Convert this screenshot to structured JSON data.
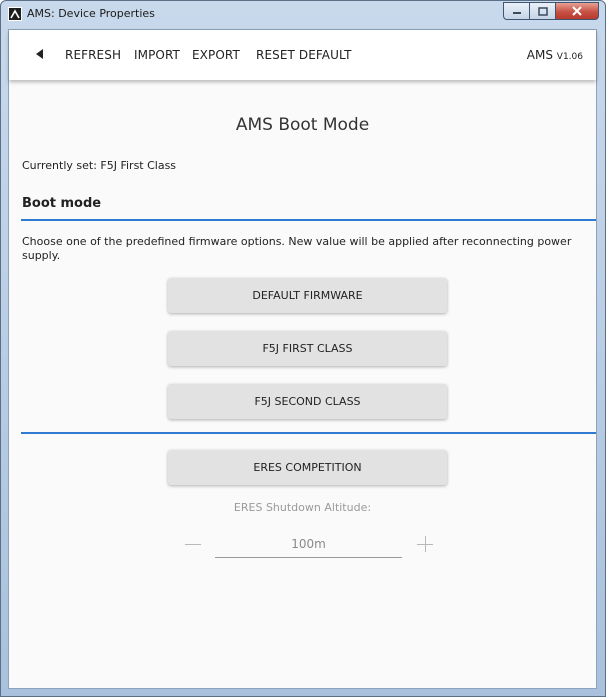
{
  "window": {
    "title": "AMS: Device Properties",
    "controls": {
      "minimize": "minimize",
      "maximize": "maximize",
      "close": "close"
    }
  },
  "toolbar": {
    "refresh": "REFRESH",
    "import": "IMPORT",
    "export": "EXPORT",
    "reset_default": "RESET DEFAULT",
    "app_name": "AMS",
    "version": "V1.06"
  },
  "main": {
    "title": "AMS Boot Mode",
    "current": "Currently set: F5J First Class",
    "section_title": "Boot mode",
    "description": "Choose one of the predefined firmware options. New value will be applied after reconnecting power supply.",
    "buttons": [
      "DEFAULT FIRMWARE",
      "F5J FIRST CLASS",
      "F5J SECOND CLASS"
    ],
    "eres_button": "ERES COMPETITION",
    "eres_label": "ERES Shutdown Altitude:",
    "altitude_value": "100m"
  },
  "colors": {
    "accent": "#2f7ad0",
    "button_bg": "#e2e2e2"
  }
}
